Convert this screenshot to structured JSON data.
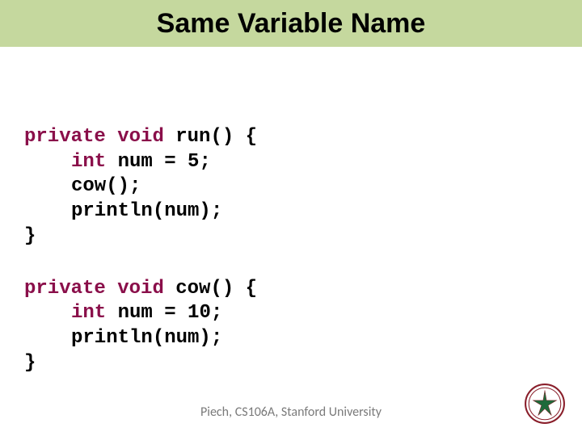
{
  "title": "Same Variable Name",
  "code": {
    "block1": {
      "l1a": "private",
      "l1b": " ",
      "l1c": "void",
      "l1d": " run() {",
      "l2a": "int",
      "l2b": " num = 5;",
      "l3": "cow();",
      "l4": "println(num);",
      "l5": "}"
    },
    "block2": {
      "l1a": "private",
      "l1b": " ",
      "l1c": "void",
      "l1d": " cow() {",
      "l2a": "int",
      "l2b": " num = 10;",
      "l3": "println(num);",
      "l4": "}"
    }
  },
  "footer": "Piech, CS106A, Stanford University"
}
